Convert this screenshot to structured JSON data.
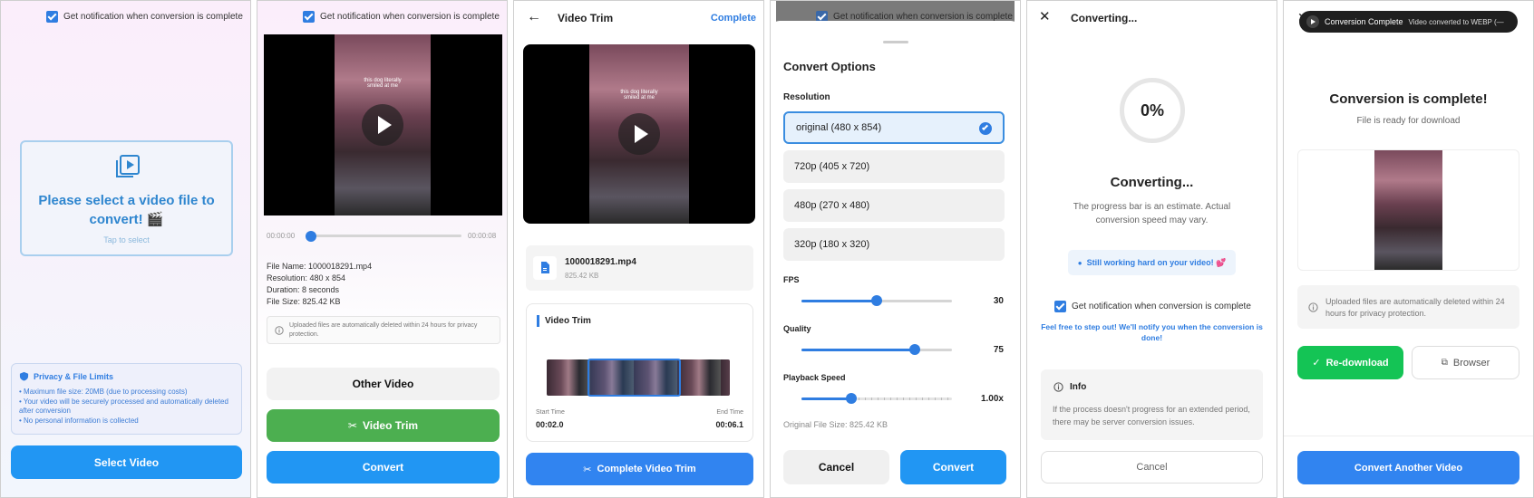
{
  "notify_label": "Get notification when conversion is complete",
  "s1": {
    "prompt": "Please select a video file to convert! 🎬",
    "tap": "Tap to select",
    "privacy_title": "Privacy & File Limits",
    "privacy_items": [
      "• Maximum file size: 20MB (due to processing costs)",
      "• Your video will be securely processed and automatically deleted after conversion",
      "• No personal information is collected"
    ],
    "select_btn": "Select Video"
  },
  "s2": {
    "overlay_text": "this dog literally smiled at me",
    "time_start": "00:00:00",
    "time_end": "00:00:08",
    "file_name": "File Name: 1000018291.mp4",
    "resolution": "Resolution: 480 x 854",
    "duration": "Duration: 8 seconds",
    "file_size": "File Size: 825.42 KB",
    "notice": "Uploaded files are automatically deleted within 24 hours for privacy protection.",
    "other_btn": "Other Video",
    "trim_btn": "Video Trim",
    "convert_btn": "Convert"
  },
  "s3": {
    "title": "Video Trim",
    "complete": "Complete",
    "overlay_text": "this dog literally smiled at me",
    "file_name": "1000018291.mp4",
    "file_size": "825.42 KB",
    "section": "Video Trim",
    "start_label": "Start Time",
    "start_val": "00:02.0",
    "end_label": "End Time",
    "end_val": "00:06.1",
    "complete_btn": "Complete Video Trim"
  },
  "s4": {
    "title": "Convert Options",
    "res_label": "Resolution",
    "options": [
      "original (480 x 854)",
      "720p (405 x 720)",
      "480p (270 x 480)",
      "320p (180 x 320)"
    ],
    "fps_label": "FPS",
    "fps_val": "30",
    "quality_label": "Quality",
    "quality_val": "75",
    "speed_label": "Playback Speed",
    "speed_val": "1.00x",
    "orig_size": "Original File Size: 825.42 KB",
    "cancel": "Cancel",
    "convert": "Convert",
    "fps_fraction": 0.5,
    "quality_fraction": 0.75,
    "speed_fraction": 0.33
  },
  "s5": {
    "title": "Converting...",
    "percent": "0%",
    "heading": "Converting...",
    "estimate": "The progress bar is an estimate. Actual conversion speed may vary.",
    "working": "Still working hard on your video! 💕",
    "stepout": "Feel free to step out! We'll notify you when the conversion is done!",
    "info_title": "Info",
    "info_text": "If the process doesn't progress for an extended period, there may be server conversion issues.",
    "cancel": "Cancel"
  },
  "s6": {
    "toast_title": "Conversion Complete",
    "toast_text": "Video converted to WEBP (—",
    "heading": "Conversion is complete!",
    "sub": "File is ready for download",
    "notice": "Uploaded files are automatically deleted within 24 hours for privacy protection.",
    "redownload": "Re-download",
    "browser": "Browser",
    "another": "Convert Another Video"
  },
  "colors": {
    "accent": "#2f7de1",
    "green": "#2fa84f",
    "bright_green": "#14c455",
    "blue_btn": "#2196f3"
  }
}
